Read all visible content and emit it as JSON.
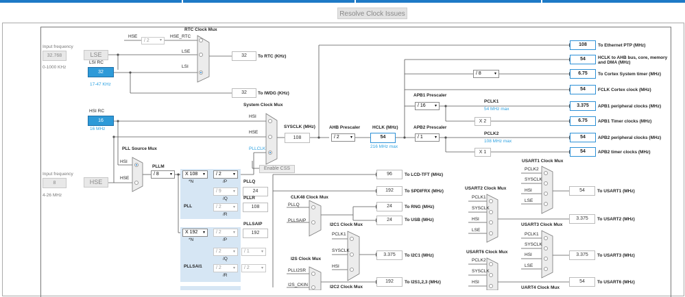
{
  "toolbar": {
    "resolve_label": "Resolve Clock Issues"
  },
  "inputs": {
    "lse_freq_label": "Input frequency",
    "lse_freq_value": "32.768",
    "lse_range": "0-1000 KHz",
    "lse": "LSE",
    "lsi_rc": "LSI RC",
    "lsi_value": "32",
    "lsi_range": "17-47 KHz",
    "hsi_rc": "HSI RC",
    "hsi_value": "16",
    "hsi_mhz": "16 MHz",
    "hse_freq_label": "Input frequency",
    "hse_freq_value": "8",
    "hse_range": "4-26 MHz",
    "hse": "HSE"
  },
  "rtc": {
    "title": "RTC Clock Mux",
    "hse": "HSE",
    "div": "/ 2",
    "hse_rtc": "HSE_RTC",
    "lse": "LSE",
    "lsi": "LSI",
    "value": "32",
    "to": "To RTC (KHz)"
  },
  "iwdg": {
    "value": "32",
    "to": "To IWDG (KHz)"
  },
  "sysmux": {
    "title": "System Clock Mux",
    "hsi": "HSI",
    "hse": "HSE",
    "pllclk": "PLLCLK",
    "sysclk_label": "SYSCLK (MHz)",
    "sysclk_value": "108",
    "ahb_label": "AHB Prescaler",
    "ahb_value": "/ 2",
    "hclk_label": "HCLK (MHz)",
    "hclk_value": "54",
    "hclk_max": "216 MHz max",
    "enable_css": "Enable CSS"
  },
  "pll": {
    "source_mux": "PLL Source Mux",
    "hsi": "HSI",
    "hse": "HSE",
    "pllm_label": "PLLM",
    "pllm_value": "/ 8",
    "pll_label": "PLL",
    "n_value": "X 108",
    "n_label": "*N",
    "p_value": "/ 2",
    "p_label": "/P",
    "q_value": "/ 9",
    "q_label": "/Q",
    "r_value": "/ 2",
    "r_label": "/R",
    "pllq": "PLLQ",
    "pllq_value": "24",
    "pllr": "PLLR",
    "pllr_value": "108"
  },
  "pllsai": {
    "label": "PLLSAI1",
    "n_value": "X 192",
    "n_label": "*N",
    "p_value": "/ 2",
    "p_label": "/P",
    "q_value": "/ 2",
    "q_label": "/Q",
    "q2_value": "/ 1",
    "r_value": "/ 2",
    "r_label": "/R",
    "r2_value": "/ 2",
    "pllsaip": "PLLSAIP",
    "pllsaip_value": "192"
  },
  "outputs": {
    "eth_value": "108",
    "eth": "To Ethernet PTP (MHz)",
    "hclk_ahb_value": "54",
    "hclk_ahb": "HCLK to AHB bus, core, memory and DMA (MHz)",
    "cortex_div": "/ 8",
    "cortex_value": "6.75",
    "cortex": "To Cortex System timer (MHz)",
    "fclk_value": "54",
    "fclk": "FCLK Cortex clock (MHz)",
    "apb1_label": "APB1 Prescaler",
    "apb1_div": "/ 16",
    "pclk1": "PCLK1",
    "pclk1_max": "54 MHz max",
    "apb1_periph_value": "3.375",
    "apb1_periph": "APB1 peripheral clocks (MHz)",
    "apb1_x": "X 2",
    "apb1_timer_value": "6.75",
    "apb1_timer": "APB1 Timer clocks (MHz)",
    "apb2_label": "APB2 Prescaler",
    "apb2_div": "/ 1",
    "pclk2": "PCLK2",
    "pclk2_max": "108 MHz max",
    "apb2_periph_value": "54",
    "apb2_periph": "APB2 peripheral clocks (MHz)",
    "apb2_x": "X 1",
    "apb2_timer_value": "54",
    "apb2_timer": "APB2 timer clocks (MHz)"
  },
  "periph": {
    "lcd_value": "96",
    "lcd": "To LCD-TFT (MHz)",
    "spdif_value": "192",
    "spdif": "To SPDIFRX (MHz)",
    "clk48_title": "CLK48 Clock Mux",
    "pllq": "PLLQ",
    "pllsaip": "PLLSAIP",
    "rng_value": "24",
    "rng": "To RNG (MHz)",
    "usb_value": "24",
    "usb": "To USB (MHz)",
    "i2c1_title": "I2C1 Clock Mux",
    "i2c1_pclk1": "PCLK1",
    "i2c1_sysclk": "SYSCLK",
    "i2c1_hsi": "HSI",
    "i2c1_value": "3.375",
    "i2c1": "To I2C1 (MHz)",
    "i2s_title": "I2S Clock Mux",
    "i2s_pll": "PLLI2SR",
    "i2s_ckin": "I2S_CKIN",
    "i2s_value": "192",
    "i2s": "To I2S1,2,3 (MHz)",
    "i2c2_title": "I2C2 Clock Mux"
  },
  "usart": {
    "u1_title": "USART1 Clock Mux",
    "u1_pclk2": "PCLK2",
    "u1_sysclk": "SYSCLK",
    "u1_hsi": "HSI",
    "u1_lse": "LSE",
    "u1_value": "54",
    "u1": "To USART1 (MHz)",
    "u2_title": "USART2 Clock Mux",
    "u2_pclk1": "PCLK1",
    "u2_sysclk": "SYSCLK",
    "u2_hsi": "HSI",
    "u2_lse": "LSE",
    "u2_value": "3.375",
    "u2": "To USART2 (MHz)",
    "u3_title": "USART3 Clock Mux",
    "u3_pclk1": "PCLK1",
    "u3_sysclk": "SYSCLK",
    "u3_hsi": "HSI",
    "u3_lse": "LSE",
    "u3_value": "3.375",
    "u3": "To USART3 (MHz)",
    "u6_title": "USART6 Clock Mux",
    "u6_pclk2": "PCLK2",
    "u6_sysclk": "SYSCLK",
    "u6_hsi": "HSI",
    "u6_value": "54",
    "u6": "To USART6 (MHz)",
    "u4_title": "UART4 Clock Mux"
  }
}
